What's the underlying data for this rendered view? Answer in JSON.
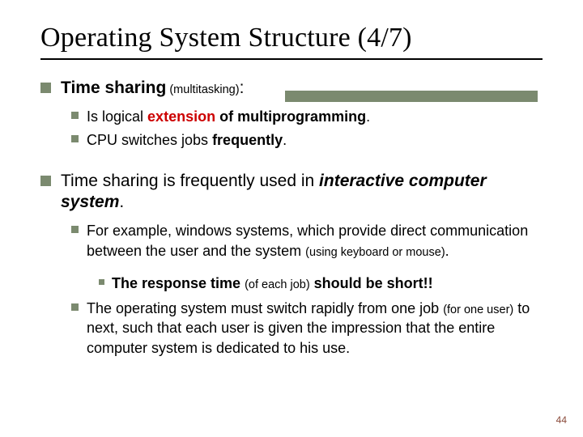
{
  "title": "Operating System Structure (4/7)",
  "b1": {
    "prefix": "Time sharing",
    "paren": " (multitasking)",
    "colon": ":"
  },
  "b1s": {
    "a_pre": "Is logical ",
    "a_ext": "extension",
    "a_post": " of multiprogramming",
    "a_dot": ".",
    "b_pre": "CPU switches jobs ",
    "b_key": "frequently",
    "b_dot": "."
  },
  "b2": {
    "pre": "Time sharing is frequently used in ",
    "key": "interactive computer system",
    "dot": "."
  },
  "b2s": {
    "a_pre": "For example, windows systems, which provide direct communication between the user and the system ",
    "a_paren": "(using keyboard or mouse)",
    "a_dot": ".",
    "a1_pre": "The response time ",
    "a1_paren": "(of each job)",
    "a1_post": " should be short!!",
    "b_pre": "The operating system must switch rapidly from one job ",
    "b_paren": "(for one user)",
    "b_post": " to next, such that each user is given the impression that the entire computer system is dedicated to his use."
  },
  "page": "44"
}
